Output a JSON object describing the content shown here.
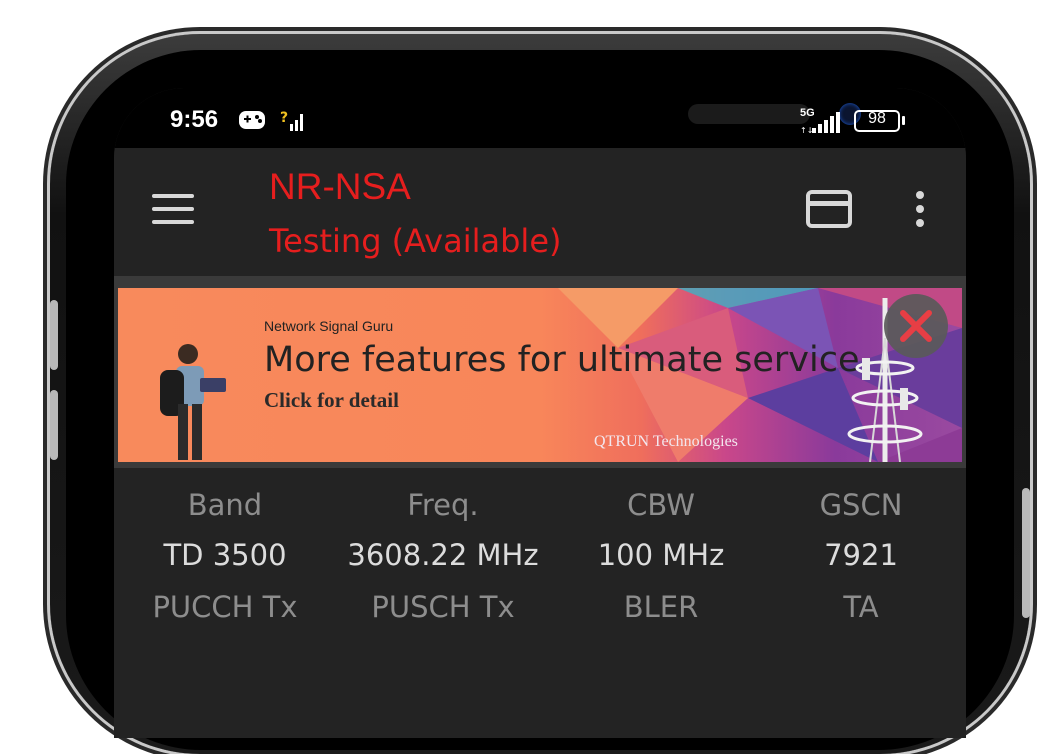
{
  "status": {
    "time": "9:56",
    "network": "5G",
    "battery": "98"
  },
  "app": {
    "title": "NR-NSA",
    "subtitle": "Testing (Available)"
  },
  "ad": {
    "brand": "Network Signal Guru",
    "headline": "More features for ultimate service",
    "cta": "Click for detail",
    "company": "QTRUN Technologies"
  },
  "table": {
    "headers": [
      "Band",
      "Freq.",
      "CBW",
      "GSCN"
    ],
    "values": [
      "TD 3500",
      "3608.22 MHz",
      "100 MHz",
      "7921"
    ],
    "headers2": [
      "PUCCH Tx",
      "PUSCH Tx",
      "BLER",
      "TA"
    ]
  },
  "colors": {
    "accent": "#e61e1e",
    "background": "#232323"
  },
  "icons": [
    "hamburger-menu-icon",
    "card-icon",
    "more-vert-icon",
    "gamepad-icon",
    "signal-icon",
    "battery-icon",
    "close-icon"
  ]
}
